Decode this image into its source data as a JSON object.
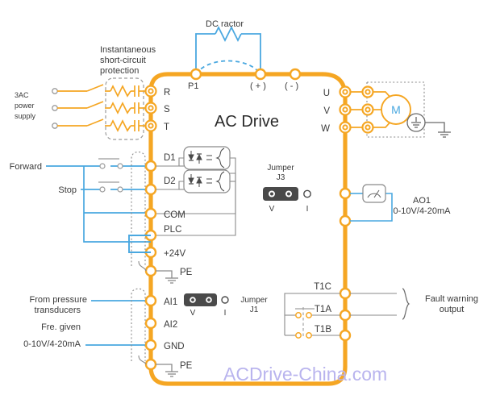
{
  "diagram": {
    "title": "AC Drive",
    "watermark": "ACDrive-China.com",
    "colors": {
      "bus": "#F5A623",
      "signal": "#4AA8E0",
      "wire_gray": "#8a8a8a",
      "text": "#3a3a3a",
      "watermark": "#b9b4ee",
      "jumper_body": "#4a4a4a"
    }
  },
  "labels": {
    "power_supply": [
      "3AC",
      "power",
      "supply"
    ],
    "short_circuit_protection": [
      "Instantaneous",
      "short-circuit",
      "protection"
    ],
    "dc_reactor": "DC ractor",
    "p1": "P1",
    "plus": "( + )",
    "minus": "( - )",
    "forward": "Forward",
    "stop": "Stop",
    "from_pressure": [
      "From pressure",
      "transducers"
    ],
    "fre_given": "Fre. given",
    "analog_range": "0-10V/4-20mA",
    "ao1": "AO1",
    "ao1_range": "0-10V/4-20mA",
    "fault_warning": [
      "Fault warning",
      "output"
    ],
    "motor": "M"
  },
  "terminals": {
    "input": [
      "R",
      "S",
      "T"
    ],
    "output": [
      "U",
      "V",
      "W"
    ],
    "digital": [
      "D1",
      "D2"
    ],
    "common": [
      "COM",
      "PLC",
      "+24V"
    ],
    "pe_upper": "PE",
    "analog": [
      "AI1",
      "AI2",
      "GND"
    ],
    "pe_lower": "PE",
    "relay": [
      "T1C",
      "T1A",
      "T1B"
    ]
  },
  "jumpers": [
    {
      "name": "Jumper",
      "id": "J3",
      "left_option": "V",
      "right_option": "I",
      "selected": "V"
    },
    {
      "name": "Jumper",
      "id": "J1",
      "left_option": "V",
      "right_option": "I",
      "selected": "V"
    }
  ]
}
